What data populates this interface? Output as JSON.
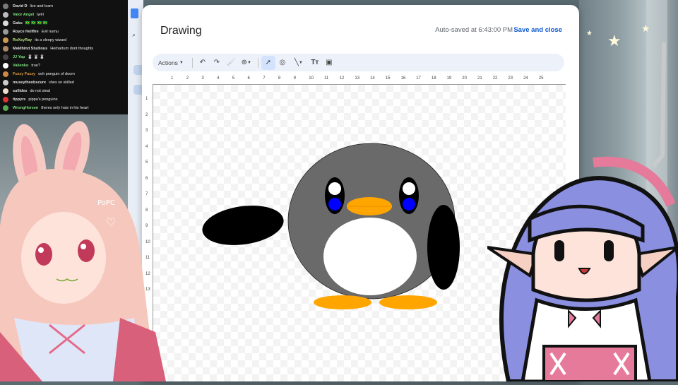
{
  "chat": {
    "messages": [
      {
        "user": "David D",
        "text": "live and learn",
        "color": "#e0e0e0",
        "avatar": "#7a7a7a"
      },
      {
        "user": "Valor Angel",
        "text": "twirl",
        "color": "#7ee07e",
        "avatar": "#bbb"
      },
      {
        "user": "Gaku",
        "text": "🇧🇷 🇧🇷 🇧🇷 🇧🇷",
        "color": "#e0e0e0",
        "avatar": "#ddd"
      },
      {
        "user": "Royce Hellfire",
        "text": "Evil numu",
        "color": "#e0e0e0",
        "avatar": "#999"
      },
      {
        "user": "RoXsyRay",
        "text": "its a sleepy wizard",
        "color": "#b7e07e",
        "avatar": "#c95"
      },
      {
        "user": "Maldhind Studious",
        "text": "Herbartum dont thoughts",
        "color": "#e0e0e0",
        "avatar": "#a86"
      },
      {
        "user": "JJ Yap",
        "text": "🐰 🐰 🐰",
        "color": "#7ee07e",
        "avatar": "#444"
      },
      {
        "user": "Valienko",
        "text": "true?",
        "color": "#7ee07e",
        "avatar": "#fff"
      },
      {
        "user": "Fuzzy Fuzzy",
        "text": "ooh penguin of doom",
        "color": "#e0a040",
        "avatar": "#c84"
      },
      {
        "user": "museytheobscure",
        "text": "shes so skilled",
        "color": "#e0e0e0",
        "avatar": "#ccc"
      },
      {
        "user": "sullides",
        "text": "do not steal",
        "color": "#e0e0e0",
        "avatar": "#edc"
      },
      {
        "user": "tippyrs",
        "text": "pippa's penguins",
        "color": "#e0e0e0",
        "avatar": "#d33"
      },
      {
        "user": "WrongHorsen",
        "text": "theres only hats in his heart",
        "color": "#7ee07e",
        "avatar": "#5a5"
      }
    ]
  },
  "dialog": {
    "title": "Drawing",
    "autosave": "Auto-saved at 6:43:00 PM",
    "save_close": "Save and close"
  },
  "toolbar": {
    "actions_label": "Actions",
    "icons": [
      "undo-icon",
      "redo-icon",
      "paint-format-icon",
      "zoom-icon",
      "select-icon",
      "shape-icon",
      "line-icon",
      "text-box-icon",
      "image-icon"
    ]
  },
  "ruler": {
    "h_ticks": [
      "1",
      "2",
      "3",
      "4",
      "5",
      "6",
      "7",
      "8",
      "9",
      "10",
      "11",
      "12",
      "13",
      "14",
      "15",
      "16",
      "17",
      "18",
      "19",
      "20",
      "21",
      "22",
      "23",
      "24",
      "25"
    ],
    "v_ticks": [
      "1",
      "2",
      "3",
      "4",
      "5",
      "6",
      "7",
      "8",
      "9",
      "10",
      "11",
      "12",
      "13"
    ]
  },
  "drawing": {
    "body_color": "#6a6a6a",
    "belly_color": "#ffffff",
    "beak_color": "#ffa500",
    "pupil_color": "#0000ff",
    "wing_color": "#000000"
  }
}
